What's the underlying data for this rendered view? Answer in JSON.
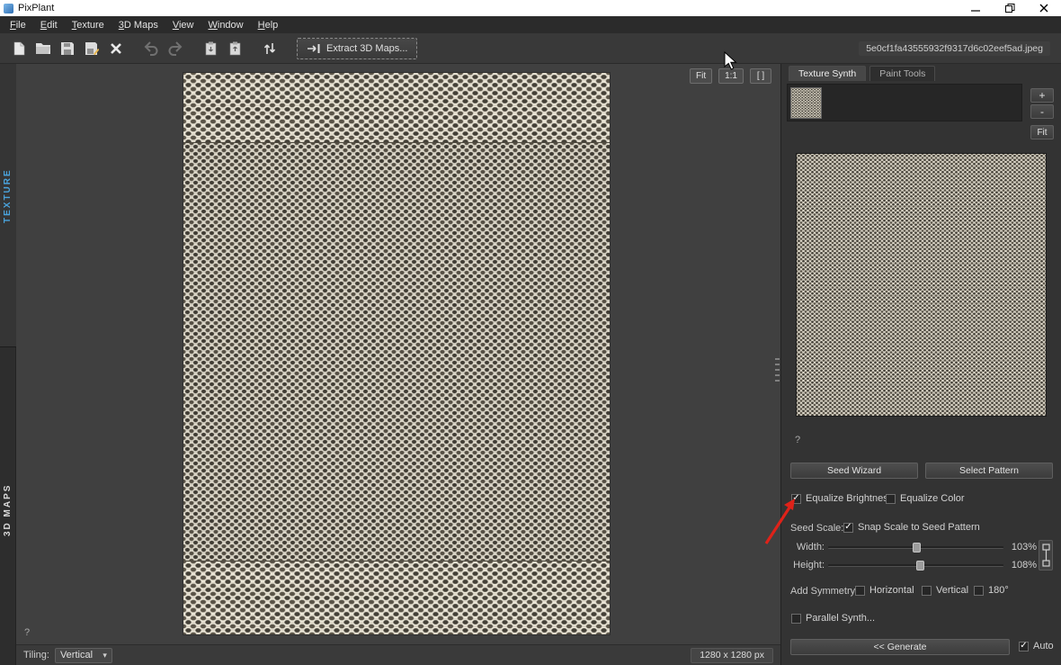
{
  "window": {
    "title": "PixPlant"
  },
  "menu": {
    "items": [
      "File",
      "Edit",
      "Texture",
      "3D Maps",
      "View",
      "Window",
      "Help"
    ]
  },
  "toolbar": {
    "extract_label": "Extract 3D Maps...",
    "filename": "5e0cf1fa43555932f9317d6c02eef5ad.jpeg"
  },
  "left_tabs": {
    "texture": "TEXTURE",
    "maps3d": "3D MAPS"
  },
  "viewport": {
    "fit_label": "Fit",
    "actual_label": "1:1",
    "expand_label": "[ ]",
    "help": "?"
  },
  "statusbar": {
    "tiling_label": "Tiling:",
    "tiling_value": "Vertical",
    "size": "1280 x 1280 px"
  },
  "panel": {
    "tabs": [
      {
        "label": "Texture Synth",
        "active": true
      },
      {
        "label": "Paint Tools",
        "active": false
      }
    ],
    "fit_label": "Fit",
    "help": "?",
    "seed_wizard_label": "Seed Wizard",
    "select_pattern_label": "Select Pattern",
    "equalize_brightness": {
      "label": "Equalize Brightness",
      "checked": true
    },
    "equalize_color": {
      "label": "Equalize Color",
      "checked": false
    },
    "seed_scale_label": "Seed Scale:",
    "snap_scale": {
      "label": "Snap Scale to Seed Pattern",
      "checked": true
    },
    "width": {
      "label": "Width:",
      "value": "103%"
    },
    "height": {
      "label": "Height:",
      "value": "108%"
    },
    "add_symmetry_label": "Add Symmetry:",
    "symmetry": [
      {
        "label": "Horizontal",
        "checked": false
      },
      {
        "label": "Vertical",
        "checked": false
      },
      {
        "label": "180°",
        "checked": false
      }
    ],
    "parallel_synth": {
      "label": "Parallel Synth...",
      "checked": false
    },
    "generate_label": "<< Generate",
    "auto": {
      "label": "Auto",
      "checked": true
    }
  },
  "icons": {
    "check": "✓",
    "chevron_down": "▾",
    "plus": "+",
    "minus": "-"
  },
  "colors": {
    "annotation_arrow": "#df2219",
    "texture_light": "#dcd7c8",
    "texture_dark": "#45413a",
    "active_tab_text": "#4aa3dc"
  }
}
